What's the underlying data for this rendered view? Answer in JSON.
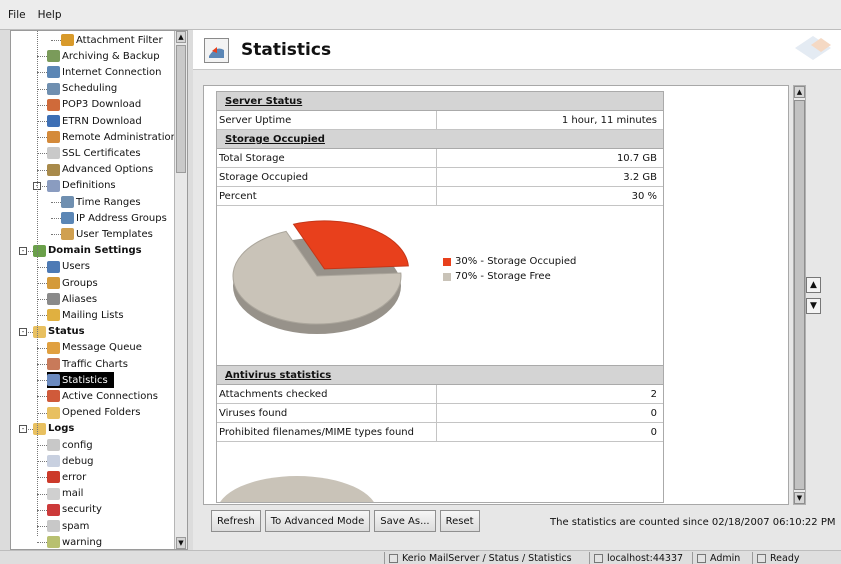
{
  "menu": {
    "file": "File",
    "help": "Help"
  },
  "tree": [
    {
      "label": "Attachment Filter",
      "depth": 2,
      "icon": "filter-icon",
      "color": "#d89a2b"
    },
    {
      "label": "Archiving & Backup",
      "depth": 1,
      "icon": "archive-icon",
      "color": "#7a9b5a"
    },
    {
      "label": "Internet Connection",
      "depth": 1,
      "icon": "network-icon",
      "color": "#5b86b5"
    },
    {
      "label": "Scheduling",
      "depth": 1,
      "icon": "clock-icon",
      "color": "#6f8fb0"
    },
    {
      "label": "POP3 Download",
      "depth": 1,
      "icon": "download-icon",
      "color": "#cf6a3a"
    },
    {
      "label": "ETRN Download",
      "depth": 1,
      "icon": "download-icon",
      "color": "#3d6fb5"
    },
    {
      "label": "Remote Administration",
      "depth": 1,
      "icon": "remote-icon",
      "color": "#d48a3a"
    },
    {
      "label": "SSL Certificates",
      "depth": 1,
      "icon": "certificate-icon",
      "color": "#c9c9c9"
    },
    {
      "label": "Advanced Options",
      "depth": 1,
      "icon": "options-icon",
      "color": "#a88a4a"
    },
    {
      "label": "Definitions",
      "depth": 1,
      "icon": "definitions-icon",
      "color": "#8a9cc0",
      "expander": "-"
    },
    {
      "label": "Time Ranges",
      "depth": 2,
      "icon": "time-icon",
      "color": "#6f8fb0"
    },
    {
      "label": "IP Address Groups",
      "depth": 2,
      "icon": "ip-icon",
      "color": "#5b86b5"
    },
    {
      "label": "User Templates",
      "depth": 2,
      "icon": "template-icon",
      "color": "#d0a050"
    },
    {
      "label": "Domain Settings",
      "depth": 0,
      "icon": "globe-icon",
      "color": "#6aa04a",
      "bold": true,
      "expander": "-"
    },
    {
      "label": "Users",
      "depth": 1,
      "icon": "user-icon",
      "color": "#4d7ab5"
    },
    {
      "label": "Groups",
      "depth": 1,
      "icon": "groups-icon",
      "color": "#d49a3a"
    },
    {
      "label": "Aliases",
      "depth": 1,
      "icon": "aliases-icon",
      "color": "#8a8a8a"
    },
    {
      "label": "Mailing Lists",
      "depth": 1,
      "icon": "mailing-list-icon",
      "color": "#e0b040"
    },
    {
      "label": "Status",
      "depth": 0,
      "icon": "folder-icon",
      "color": "#e8c060",
      "bold": true,
      "expander": "-"
    },
    {
      "label": "Message Queue",
      "depth": 1,
      "icon": "queue-icon",
      "color": "#e0a040"
    },
    {
      "label": "Traffic Charts",
      "depth": 1,
      "icon": "chart-icon",
      "color": "#c87a5a"
    },
    {
      "label": "Statistics",
      "depth": 1,
      "icon": "statistics-icon",
      "color": "#6a8ac0",
      "selected": true
    },
    {
      "label": "Active Connections",
      "depth": 1,
      "icon": "connections-icon",
      "color": "#d05a3a"
    },
    {
      "label": "Opened Folders",
      "depth": 1,
      "icon": "folder-icon",
      "color": "#e8c060"
    },
    {
      "label": "Logs",
      "depth": 0,
      "icon": "folder-icon",
      "color": "#e8c060",
      "bold": true,
      "expander": "-"
    },
    {
      "label": "config",
      "depth": 1,
      "icon": "log-icon",
      "color": "#c8c8c8"
    },
    {
      "label": "debug",
      "depth": 1,
      "icon": "log-icon",
      "color": "#c8d0e0"
    },
    {
      "label": "error",
      "depth": 1,
      "icon": "error-icon",
      "color": "#cc3a2a"
    },
    {
      "label": "mail",
      "depth": 1,
      "icon": "log-icon",
      "color": "#d0d0d0"
    },
    {
      "label": "security",
      "depth": 1,
      "icon": "security-icon",
      "color": "#cc3a3a"
    },
    {
      "label": "spam",
      "depth": 1,
      "icon": "log-icon",
      "color": "#c8c8c8"
    },
    {
      "label": "warning",
      "depth": 1,
      "icon": "warning-icon",
      "color": "#b8c070"
    }
  ],
  "header": {
    "title": "Statistics"
  },
  "server_status": {
    "title": "Server Status",
    "rows": [
      {
        "k": "Server Uptime",
        "v": "1 hour, 11 minutes"
      }
    ]
  },
  "storage": {
    "title": "Storage Occupied",
    "rows": [
      {
        "k": "Total Storage",
        "v": "10.7 GB"
      },
      {
        "k": "Storage Occupied",
        "v": "3.2 GB"
      },
      {
        "k": "Percent",
        "v": "30 %"
      }
    ]
  },
  "chart_data": {
    "type": "pie",
    "slices": [
      {
        "label": "30% - Storage Occupied",
        "value": 30,
        "color": "#e8401c"
      },
      {
        "label": "70% - Storage Free",
        "value": 70,
        "color": "#c9c3b8"
      }
    ],
    "legend": "right"
  },
  "antivirus": {
    "title": "Antivirus statistics",
    "rows": [
      {
        "k": "Attachments checked",
        "v": "2"
      },
      {
        "k": "Viruses found",
        "v": "0"
      },
      {
        "k": "Prohibited filenames/MIME types found",
        "v": "0"
      }
    ]
  },
  "buttons": {
    "refresh": "Refresh",
    "advanced": "To Advanced Mode",
    "save": "Save As...",
    "reset": "Reset"
  },
  "since_text": "The statistics are counted since 02/18/2007 06:10:22 PM",
  "statusbar": {
    "path": "Kerio MailServer / Status / Statistics",
    "host": "localhost:44337",
    "user": "Admin",
    "state": "Ready"
  }
}
